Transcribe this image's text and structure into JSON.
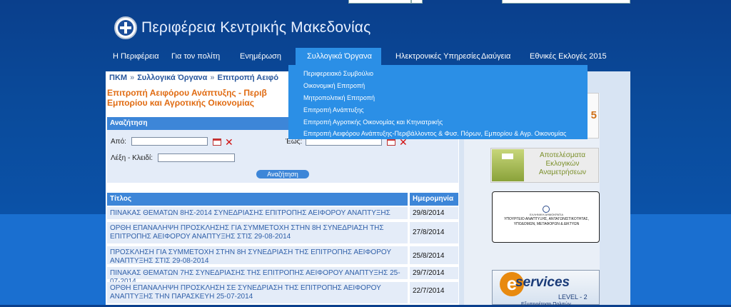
{
  "header": {
    "site_title": "Περιφέρεια Κεντρικής Μακεδονίας"
  },
  "nav": {
    "items": [
      {
        "label": "Η Περιφέρεια"
      },
      {
        "label": "Για τον πολίτη"
      },
      {
        "label": "Ενημέρωση"
      },
      {
        "label": "Συλλογικά Όργανα"
      },
      {
        "label": "Ηλεκτρονικές Υπηρεσίες"
      },
      {
        "label": "Διαύγεια"
      },
      {
        "label": "Εθνικές Εκλογές 2015"
      }
    ],
    "active_index": 3
  },
  "dropdown": {
    "items": [
      {
        "label": "Περιφερειακό Συμβούλιο"
      },
      {
        "label": "Οικονομική Επιτροπή"
      },
      {
        "label": "Μητροπολιτική Επιτροπή"
      },
      {
        "label": "Επιτροπή Ανάπτυξης"
      },
      {
        "label": "Επιτροπή Αγροτικής Οικονομίας και Κτηνιατρικής"
      },
      {
        "label": "Επιτροπή Αειφόρου Ανάπτυξης-Περιβάλλοντος & Φυσ. Πόρων, Εμπορίου & Αγρ. Οικονομίας"
      }
    ]
  },
  "breadcrumb": {
    "items": [
      {
        "label": "ΠΚΜ"
      },
      {
        "label": "Συλλογικά Όργανα"
      },
      {
        "label": "Επιτροπή Αειφό"
      }
    ],
    "separator": "»"
  },
  "page": {
    "title": "Επιτροπή Αειφόρου Ανάπτυξης - Περιβ Εμπορίου και Αγροτικής Οικονομίας"
  },
  "search": {
    "header": "Αναζήτηση",
    "from_label": "Από:",
    "to_label": "Έως:",
    "keyword_label": "Λέξη - Κλειδί:",
    "from_value": "",
    "to_value": "",
    "keyword_value": "",
    "button_label": "Αναζήτηση"
  },
  "table": {
    "columns": [
      "Τίτλος",
      "Ημερομηνία"
    ],
    "rows": [
      {
        "title": "ΠΙΝΑΚΑΣ ΘΕΜΑΤΩΝ 8ΗΣ-2014 ΣΥΝΕΔΡΙΑΣΗΣ ΕΠΙΤΡΟΠΗΣ ΑΕΙΦΟΡΟΥ ΑΝΑΠΤΥΞΗΣ",
        "date": "29/8/2014"
      },
      {
        "title": "ΟΡΘΗ ΕΠΑΝΑΛΗΨΗ ΠΡΟΣΚΛΗΣΗΣ ΓΙΑ ΣΥΜΜΕΤΟΧΗ ΣΤΗΝ 8Η ΣΥΝΕΔΡΙΑΣΗ ΤΗΣ ΕΠΙΤΡΟΠΗΣ ΑΕΙΦΟΡΟΥ ΑΝΑΠΤΥΞΗΣ ΣΤΙΣ 29-08-2014",
        "date": "27/8/2014"
      },
      {
        "title": "ΠΡΟΣΚΛΗΣΗ ΓΙΑ ΣΥΜΜΕΤΟΧΗ ΣΤΗΝ 8Η ΣΥΝΕΔΡΙΑΣΗ ΤΗΣ ΕΠΙΤΡΟΠΗΣ ΑΕΙΦΟΡΟΥ ΑΝΑΠΤΥΞΗΣ ΣΤΙΣ 29-08-2014",
        "date": "25/8/2014"
      },
      {
        "title": "ΠΙΝΑΚΑΣ ΘΕΜΑΤΩΝ 7ΗΣ ΣΥΝΕΔΡΙΑΣΗΣ ΤΗΣ ΕΠΙΤΡΟΠΗΣ ΑΕΙΦΟΡΟΥ ΑΝΑΠΤΥΞΗΣ 25-07-2014",
        "date": "29/7/2014"
      },
      {
        "title": "ΟΡΘΗ ΕΠΑΝΑΛΗΨΗ ΠΡΟΣΚΛΗΣΗ ΣΕ ΣΥΝΕΔΡΙΑΣΗ ΤΗΣ ΕΠΙΤΡΟΠΗΣ ΑΕΙΦΟΡΟΥ ΑΝΑΠΤΥΞΗΣ ΤΗΝ ΠΑΡΑΣΚΕΥΗ 25-07-2014",
        "date": "22/7/2014"
      }
    ]
  },
  "sidebar": {
    "top_banner_fragment": "5",
    "results_banner": "Αποτελέσματα Εκλογικών Αναμετρήσεων",
    "ministry_banner": {
      "small_text": "ΕΛΛΗΝΙΚΗ ΔΗΜΟΚΡΑΤΙΑ",
      "text": "ΥΠΟΥΡΓΕΙΟ ΑΝΑΠΤΥΞΗΣ, ΑΝΤΑΓΩΝΙΣΤΙΚΟΤΗΤΑΣ, ΥΠΟΔΟΜΩΝ, ΜΕΤΑΦΟΡΩΝ & ΔΙΚΤΥΩΝ"
    },
    "eservices_banner": {
      "letter": "e",
      "title": "services",
      "level": "LEVEL - 2",
      "sub": "Εξυπηρέτηση Πολιτών"
    }
  },
  "colors": {
    "nav_active": "#2b8fe6",
    "table_header": "#3d86d8",
    "title_orange": "#e06b12",
    "link_blue": "#2f5fa8"
  }
}
